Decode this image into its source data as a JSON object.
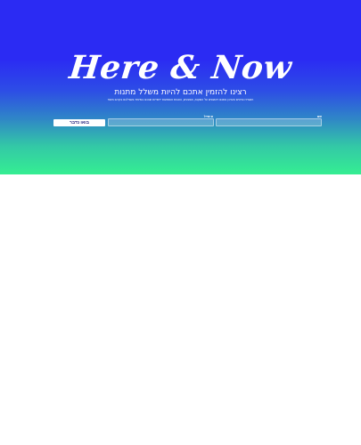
{
  "hero": {
    "logo": "Here & Now",
    "headline": "רצינו להזמין אתכם להיות משלל מתנות",
    "subtext": "השאירו פרטים ונעדכן אתכם ראשונים על השקות, מבצעים, הטבות והפתעות ייחודיות שהכנו במיוחד בשבילכם בקרוב מאוד",
    "colors": {
      "top": "#2b2bf3",
      "bottom": "#35ee92"
    }
  },
  "form": {
    "name_label": "שם",
    "name_value": "",
    "email_label": "אימייל",
    "email_value": "",
    "submit_label": "בואו נדבר"
  }
}
